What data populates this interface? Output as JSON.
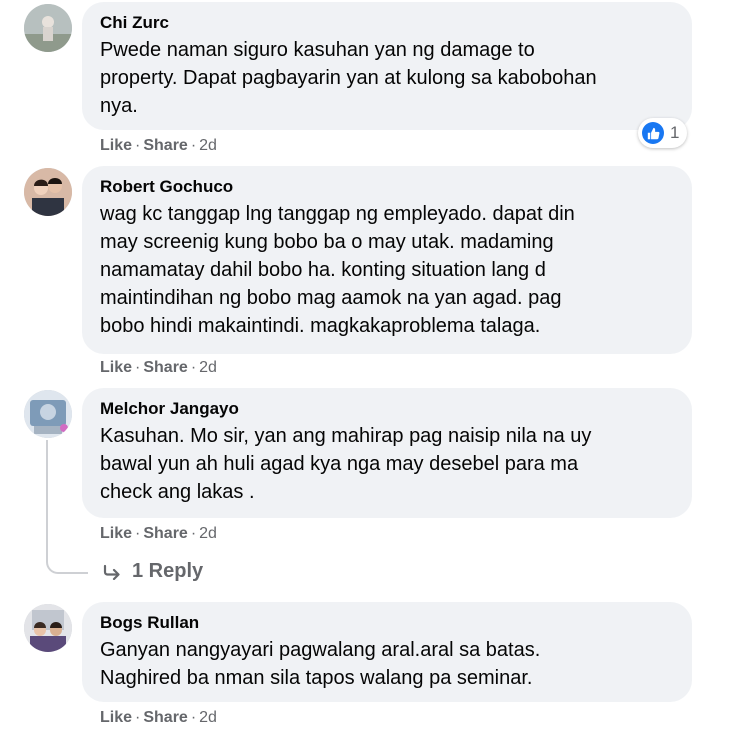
{
  "actions": {
    "like": "Like",
    "share": "Share",
    "dot": "·"
  },
  "comments": [
    {
      "author": "Chi Zurc",
      "text": "Pwede naman siguro kasuhan yan ng damage to\nproperty. Dapat pagbayarin yan at kulong sa kabobohan\nnya.",
      "time": "2d",
      "reactions": "1"
    },
    {
      "author": "Robert Gochuco",
      "text": "wag kc tanggap lng tanggap ng empleyado. dapat din\nmay screenig kung bobo ba o may utak. madaming\nnamamatay dahil bobo ha. konting situation lang d\nmaintindihan ng bobo mag aamok na yan agad. pag\nbobo hindi makaintindi. magkakaproblema talaga.",
      "time": "2d"
    },
    {
      "author": "Melchor Jangayo",
      "text": "Kasuhan. Mo sir, yan ang mahirap pag naisip nila na uy\nbawal yun ah huli agad kya nga may desebel para ma\ncheck ang lakas .",
      "time": "2d",
      "replies_label": "1 Reply"
    },
    {
      "author": "Bogs Rullan",
      "text": "Ganyan nangyayari pagwalang aral.aral sa batas.\nNaghired ba nman sila tapos walang pa seminar.",
      "time": "2d"
    }
  ],
  "colors": {
    "bubble": "#f0f2f5",
    "meta": "#65676b",
    "like_blue": "#1877f2"
  },
  "icons": {
    "like": "thumbs-up-icon",
    "reply": "reply-arrow-icon"
  }
}
